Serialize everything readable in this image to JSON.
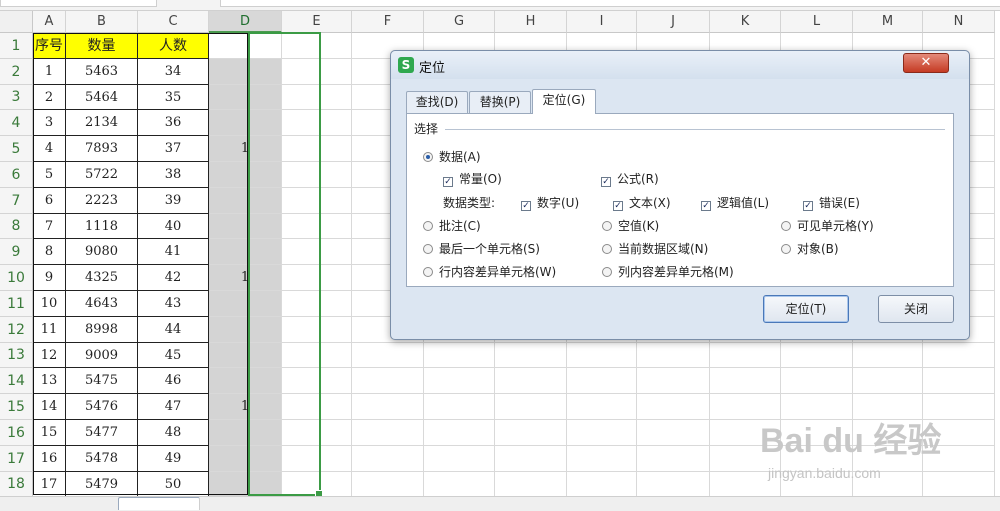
{
  "columns": [
    "A",
    "B",
    "C",
    "D",
    "E",
    "F",
    "G",
    "H",
    "I",
    "J",
    "K",
    "L",
    "M",
    "N"
  ],
  "rows": [
    "1",
    "2",
    "3",
    "4",
    "5",
    "6",
    "7",
    "8",
    "9",
    "10",
    "11",
    "12",
    "13",
    "14",
    "15",
    "16",
    "17",
    "18"
  ],
  "table": {
    "headers": [
      "序号",
      "数量",
      "人数"
    ],
    "records": [
      [
        "1",
        "5463",
        "34",
        ""
      ],
      [
        "2",
        "5464",
        "35",
        ""
      ],
      [
        "3",
        "2134",
        "36",
        ""
      ],
      [
        "4",
        "7893",
        "37",
        "1"
      ],
      [
        "5",
        "5722",
        "38",
        ""
      ],
      [
        "6",
        "2223",
        "39",
        ""
      ],
      [
        "7",
        "1118",
        "40",
        ""
      ],
      [
        "8",
        "9080",
        "41",
        ""
      ],
      [
        "9",
        "4325",
        "42",
        "1"
      ],
      [
        "10",
        "4643",
        "43",
        ""
      ],
      [
        "11",
        "8998",
        "44",
        ""
      ],
      [
        "12",
        "9009",
        "45",
        ""
      ],
      [
        "13",
        "5475",
        "46",
        ""
      ],
      [
        "14",
        "5476",
        "47",
        "1"
      ],
      [
        "15",
        "5477",
        "48",
        ""
      ],
      [
        "16",
        "5478",
        "49",
        ""
      ],
      [
        "17",
        "5479",
        "50",
        ""
      ]
    ]
  },
  "dialog": {
    "logo": "S",
    "title": "定位",
    "close": "✕",
    "tabs": [
      "查找(D)",
      "替换(P)",
      "定位(G)"
    ],
    "section": "选择",
    "data_option": "数据(A)",
    "constant": "常量(O)",
    "formula": "公式(R)",
    "data_type_label": "数据类型:",
    "types": [
      "数字(U)",
      "文本(X)",
      "逻辑值(L)",
      "错误(E)"
    ],
    "comments": "批注(C)",
    "blank": "空值(K)",
    "visible_cells": "可见单元格(Y)",
    "last_cell": "最后一个单元格(S)",
    "current_region": "当前数据区域(N)",
    "objects": "对象(B)",
    "row_diff": "行内容差异单元格(W)",
    "col_diff": "列内容差异单元格(M)",
    "locate_button": "定位(T)",
    "close_button": "关闭",
    "check_mark": "✓"
  },
  "watermark": {
    "brand": "Bai du 经验",
    "url": "jingyan.baidu.com"
  }
}
